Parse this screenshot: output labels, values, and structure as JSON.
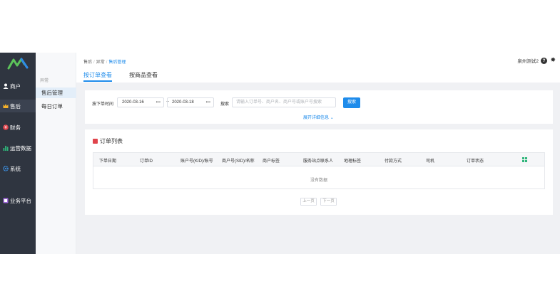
{
  "sidebar": {
    "items": [
      {
        "label": "商户",
        "icon": "user-icon",
        "color": "#ffffff"
      },
      {
        "label": "售后",
        "icon": "crown-icon",
        "color": "#f5b12a"
      },
      {
        "label": "财务",
        "icon": "money-icon",
        "color": "#e0434b"
      },
      {
        "label": "运营数据",
        "icon": "bar-chart-icon",
        "color": "#2fb57a"
      },
      {
        "label": "系统",
        "icon": "gear-icon",
        "color": "#3d8fe0"
      },
      {
        "label": "业务平台",
        "icon": "platform-icon",
        "color": "#a46be0"
      }
    ]
  },
  "submenu": {
    "group": "异常",
    "items": [
      {
        "label": "售后管理"
      },
      {
        "label": "每日订单"
      }
    ]
  },
  "header": {
    "breadcrumb": [
      "售后",
      "异常",
      "售后管理"
    ],
    "user": "泉州测试2",
    "tabs": [
      {
        "label": "按订单查看"
      },
      {
        "label": "按商品查看"
      }
    ]
  },
  "filter": {
    "time_label": "按下单时间",
    "start_date": "2020-03-16",
    "end_date": "2020-03-18",
    "range_sep": "~",
    "search_label": "搜索",
    "search_placeholder": "请输入订单号、商户名、商户号或账户号搜索",
    "search_button": "搜索",
    "expand_label": "展开详细信息"
  },
  "order_list": {
    "title": "订单列表",
    "columns": [
      "下单日期",
      "订单ID",
      "账户号(KID)/账号",
      "商户号(SID)/名称",
      "商户标签",
      "服务站点联系人",
      "地理标签",
      "付款方式",
      "司机",
      "订单状态"
    ],
    "empty_text": "没有数据",
    "prev_label": "上一页",
    "next_label": "下一页"
  },
  "colors": {
    "accent": "#1f8ceb",
    "sidebar_bg": "#2f3540"
  }
}
